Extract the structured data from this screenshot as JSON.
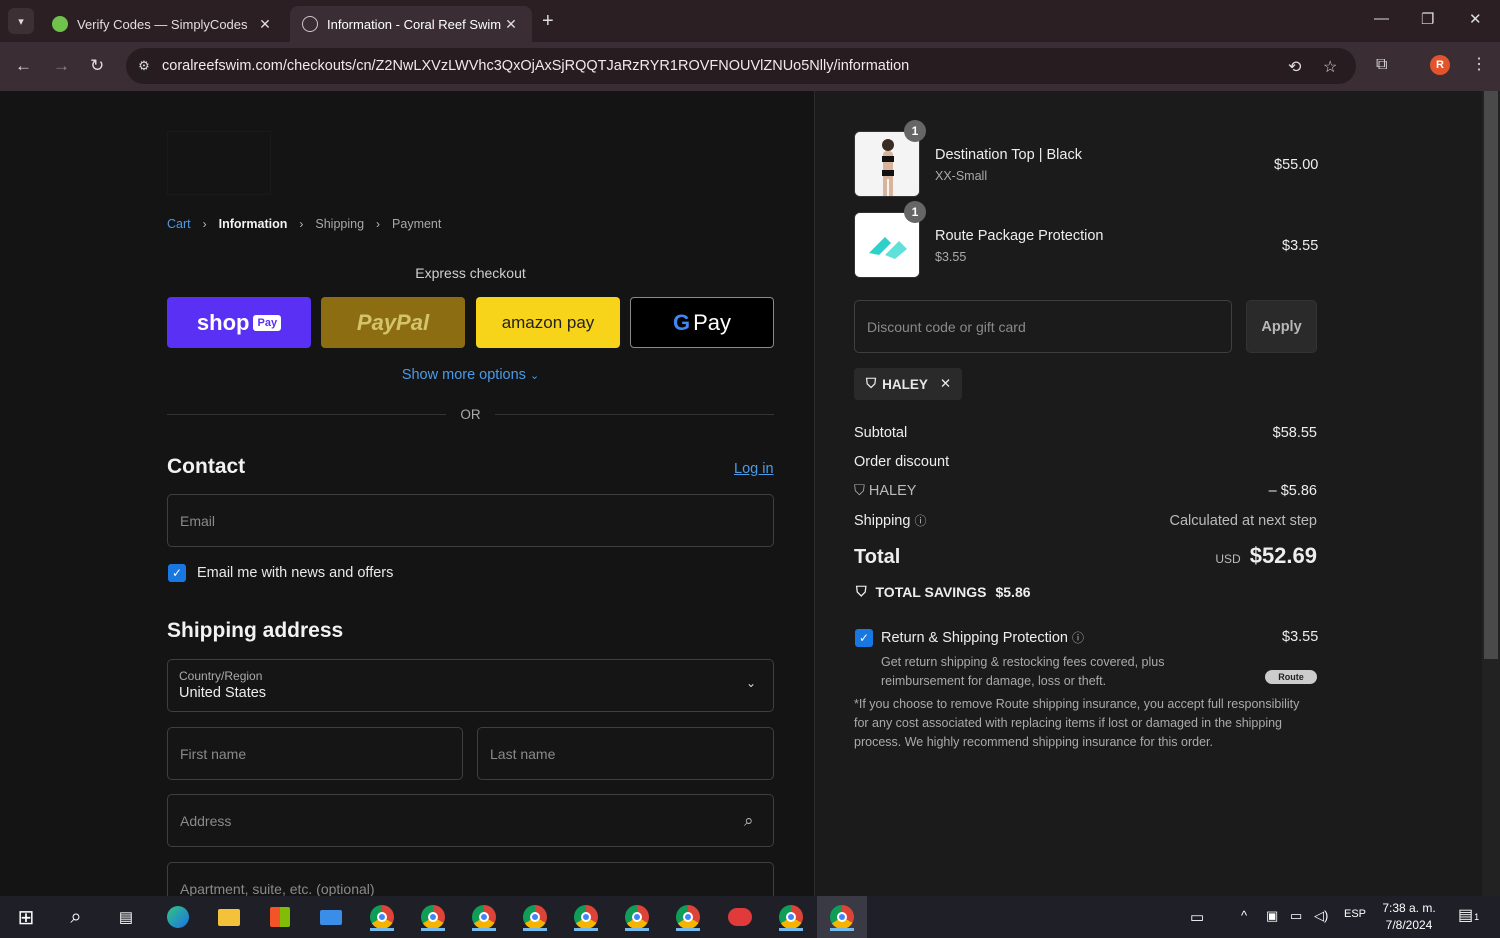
{
  "browser": {
    "tabs": [
      {
        "title": "Verify Codes — SimplyCodes",
        "active": false
      },
      {
        "title": "Information - Coral Reef Swim",
        "active": true
      }
    ],
    "url": "coralreefswim.com/checkouts/cn/Z2NwLXVzLWVhc3QxOjAxSjRQQTJaRzRYR1ROVFNOUVlZNUo5Nlly/information",
    "profile_initial": "R"
  },
  "breadcrumb": {
    "cart": "Cart",
    "information": "Information",
    "shipping": "Shipping",
    "payment": "Payment"
  },
  "express": {
    "title": "Express checkout",
    "shop_pay": "shop",
    "shop_pay_pill": "Pay",
    "paypal": "PayPal",
    "amazon_pay": "amazon pay",
    "google_pay_g": "G",
    "google_pay": "Pay",
    "show_more": "Show more options",
    "or": "OR"
  },
  "contact": {
    "heading": "Contact",
    "login": "Log in",
    "email_placeholder": "Email",
    "newsletter_label": "Email me with news and offers",
    "newsletter_checked": true
  },
  "shipping": {
    "heading": "Shipping address",
    "country_label": "Country/Region",
    "country_value": "United States",
    "first_name_placeholder": "First name",
    "last_name_placeholder": "Last name",
    "address_placeholder": "Address",
    "apartment_placeholder": "Apartment, suite, etc. (optional)"
  },
  "order": {
    "items": [
      {
        "qty": "1",
        "name": "Destination Top | Black",
        "variant": "XX-Small",
        "price": "$55.00"
      },
      {
        "qty": "1",
        "name": "Route Package Protection",
        "variant": "$3.55",
        "price": "$3.55"
      }
    ],
    "discount_placeholder": "Discount code or gift card",
    "apply": "Apply",
    "applied_code": "HALEY",
    "subtotal_label": "Subtotal",
    "subtotal_value": "$58.55",
    "order_discount_label": "Order discount",
    "discount_code": "HALEY",
    "discount_value": "– $5.86",
    "shipping_label": "Shipping",
    "shipping_value": "Calculated at next step",
    "total_label": "Total",
    "total_currency": "USD",
    "total_value": "$52.69",
    "savings_label": "TOTAL SAVINGS",
    "savings_value": "$5.86",
    "protection_label": "Return & Shipping Protection",
    "protection_price": "$3.55",
    "protection_checked": true,
    "protection_desc": "Get return shipping & restocking fees covered, plus reimbursement for damage, loss or theft.",
    "route_logo": "Route",
    "disclaimer": "*If you choose to remove Route shipping insurance, you accept full responsibility for any cost associated with replacing items if lost or damaged in the shipping process. We highly recommend shipping insurance for this order."
  },
  "taskbar": {
    "language": "ESP",
    "time": "7:38 a. m.",
    "date": "7/8/2024",
    "notifications": "1"
  },
  "colors": {
    "accent_link": "#4a9be8",
    "shop_pay": "#5a31f4",
    "amazon": "#f7d41a",
    "checkbox": "#1877e0"
  }
}
